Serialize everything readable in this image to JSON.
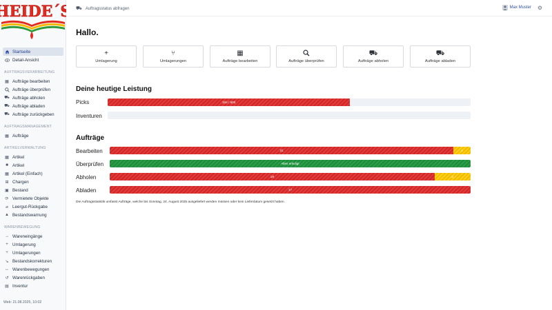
{
  "brand": {
    "name": "HEIDE´S"
  },
  "sidebar": {
    "top_items": [
      {
        "label": "Startseite",
        "icon": "home-icon",
        "active": true
      },
      {
        "label": "Detail-Ansicht",
        "icon": "eye-icon",
        "active": false
      }
    ],
    "sections": [
      {
        "title": "AUFTRAGSVERARBEITUNG",
        "items": [
          {
            "label": "Aufträge bearbeiten",
            "icon": "boxes-icon"
          },
          {
            "label": "Aufträge überprüfen",
            "icon": "search-icon"
          },
          {
            "label": "Aufträge abholen",
            "icon": "dolly-icon"
          },
          {
            "label": "Aufträge abladen",
            "icon": "truck-icon"
          },
          {
            "label": "Aufträge zurückgeben",
            "icon": "return-truck-icon"
          }
        ]
      },
      {
        "title": "AUFTRAGSMANAGEMENT",
        "items": [
          {
            "label": "Aufträge",
            "icon": "boxes-icon"
          }
        ]
      },
      {
        "title": "ARTIKELVERWALTUNG",
        "items": [
          {
            "label": "Artikel",
            "icon": "boxes-icon"
          },
          {
            "label": "Artikel",
            "icon": "box-icon"
          },
          {
            "label": "Artikel (Einfach)",
            "icon": "boxes-icon"
          },
          {
            "label": "Chargen",
            "icon": "sitemap-icon"
          },
          {
            "label": "Bestand",
            "icon": "warehouse-icon"
          },
          {
            "label": "Vermietete Objekte",
            "icon": "cycle-icon"
          },
          {
            "label": "Leergut-Rückgabe",
            "icon": "bottle-icon"
          },
          {
            "label": "Bestandswarnung",
            "icon": "warning-icon"
          }
        ]
      },
      {
        "title": "WARENBEWEGUNG",
        "items": [
          {
            "label": "Wareneingänge",
            "icon": "arrow-right-icon"
          },
          {
            "label": "Umlagerung",
            "icon": "plus-icon"
          },
          {
            "label": "Umlagerungen",
            "icon": "branch-icon"
          },
          {
            "label": "Bestandskorrekturen",
            "icon": "correction-icon"
          },
          {
            "label": "Warenbewegungen",
            "icon": "swap-icon"
          },
          {
            "label": "Warenrückgaben",
            "icon": "undo-icon"
          },
          {
            "label": "Inventur",
            "icon": "inventory-icon"
          }
        ]
      }
    ],
    "version": "Web: 21.08.2025, 10:02"
  },
  "topbar": {
    "status_link": "Auftragsstatus abfragen",
    "user_name": "Max Muster"
  },
  "main": {
    "greeting": "Hallo.",
    "actions": [
      {
        "label": "Umlagerung",
        "icon": "plus-icon"
      },
      {
        "label": "Umlagerungen",
        "icon": "branch-icon"
      },
      {
        "label": "Aufträge bearbeiten",
        "icon": "boxes-icon"
      },
      {
        "label": "Aufträge überprüfen",
        "icon": "search-icon"
      },
      {
        "label": "Aufträge abholen",
        "icon": "dolly-icon"
      },
      {
        "label": "Aufträge abladen",
        "icon": "truck-icon"
      }
    ],
    "performance": {
      "title": "Deine heutige Leistung",
      "rows": [
        {
          "label": "Picks",
          "bar_text": "334 / 500",
          "fraction": 0.668
        },
        {
          "label": "Inventuren",
          "bar_text": "",
          "fraction": 0
        }
      ]
    },
    "orders": {
      "title": "Aufträge",
      "rows": [
        {
          "label": "Bearbeiten",
          "segments": [
            {
              "color": "red",
              "text": "31",
              "fraction": 0.953
            },
            {
              "color": "yellow",
              "text": "1",
              "fraction": 0.047
            }
          ]
        },
        {
          "label": "Überprüfen",
          "segments": [
            {
              "color": "green",
              "text": "Alles erledigt",
              "fraction": 1
            }
          ]
        },
        {
          "label": "Abholen",
          "segments": [
            {
              "color": "red",
              "text": "18",
              "fraction": 0.9
            },
            {
              "color": "yellow",
              "text": "2",
              "fraction": 0.1
            }
          ]
        },
        {
          "label": "Abladen",
          "segments": [
            {
              "color": "red",
              "text": "17",
              "fraction": 1
            }
          ]
        }
      ],
      "note": "Die Auftragsstatistik umfasst Aufträge, welche bis Sonntag, 24. August 2025 ausgeliefert werden müssen oder kein Lieferdatum gesetzt haben."
    }
  },
  "colors": {
    "red": "#e33a3a",
    "yellow": "#ffcf1a",
    "green": "#2a9d48",
    "accent": "#2c4ea3"
  }
}
